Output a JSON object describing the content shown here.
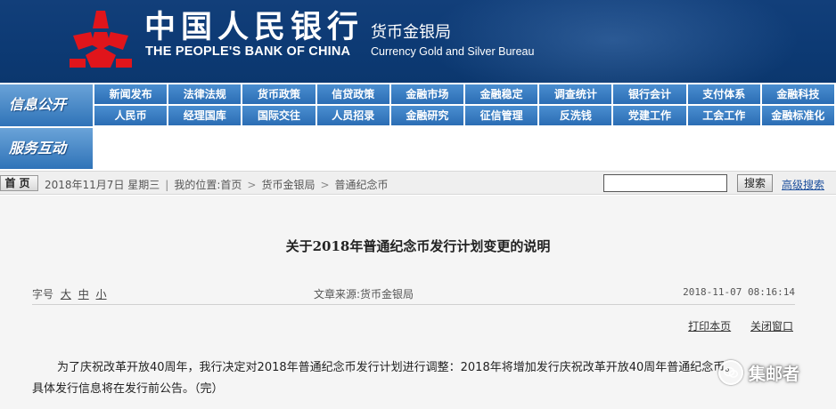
{
  "header": {
    "logo_cn": "中国人民银行",
    "logo_en": "THE PEOPLE'S BANK OF CHINA",
    "bureau_cn": "货币金银局",
    "bureau_en": "Currency  Gold and Silver Bureau",
    "emblem_icon": "pboc-emblem-icon",
    "emblem_color": "#e0151b"
  },
  "nav": {
    "info_tab": "信息公开",
    "service_tab": "服务互动",
    "row1": [
      "新闻发布",
      "法律法规",
      "货币政策",
      "信贷政策",
      "金融市场",
      "金融稳定",
      "调查统计",
      "银行会计",
      "支付体系",
      "金融科技"
    ],
    "row2": [
      "人民币",
      "经理国库",
      "国际交往",
      "人员招录",
      "金融研究",
      "征信管理",
      "反洗钱",
      "党建工作",
      "工会工作",
      "金融标准化"
    ]
  },
  "status": {
    "home": "首页",
    "date": "2018年11月7日  星期三",
    "location_label": "我的位置:",
    "breadcrumb": [
      "首页",
      "货币金银局",
      "普通纪念币"
    ],
    "search_value": "",
    "search_button": "搜索",
    "advanced_search": "高级搜索"
  },
  "article": {
    "title": "关于2018年普通纪念币发行计划变更的说明",
    "fontsize_label": "字号",
    "fontsize_options": [
      "大",
      "中",
      "小"
    ],
    "source": "文章来源:货币金银局",
    "datetime": "2018-11-07  08:16:14",
    "print": "打印本页",
    "close": "关闭窗口",
    "para1": "为了庆祝改革开放40周年，我行决定对2018年普通纪念币发行计划进行调整：2018年将增加发行庆祝改革开放40周年普通纪念币。",
    "para2": "具体发行信息将在发行前公告。（完）"
  },
  "watermark": {
    "text": "集邮者",
    "icon": "wechat-bubble-icon"
  }
}
